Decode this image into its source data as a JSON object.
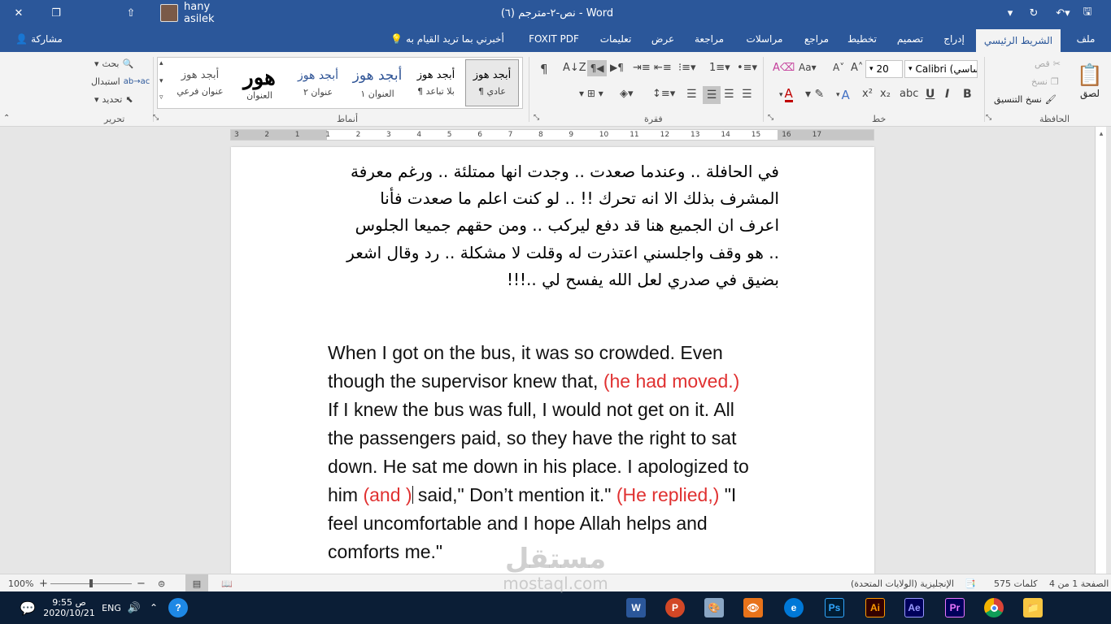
{
  "window": {
    "title": "نص-٢-مترجم (٦)  -  Word",
    "user_name": "hany asilek",
    "share_label": "مشاركة",
    "tell_me": "أخبرني بما تريد القيام به"
  },
  "tabs": [
    "ملف",
    "الشريط الرئيسي",
    "إدراج",
    "تصميم",
    "تخطيط",
    "مراجع",
    "مراسلات",
    "مراجعة",
    "عرض",
    "تعليمات",
    "FOXIT PDF"
  ],
  "active_tab": "الشريط الرئيسي",
  "ribbon": {
    "clipboard": {
      "paste": "لصق",
      "cut": "قص",
      "copy": "نسخ",
      "format_painter": "نسخ التنسيق",
      "label": "الحافظة"
    },
    "font": {
      "name": "Calibri (أساسي)",
      "size": "20",
      "label": "خط",
      "bold": "B",
      "italic": "I",
      "underline": "U",
      "grow": "A",
      "change_case": "Aa",
      "subscript": "x₂",
      "superscript": "x²",
      "text_effects": "A",
      "font_color": "A"
    },
    "paragraph": {
      "label": "فقرة",
      "pilcrow": "¶"
    },
    "styles": {
      "label": "أنماط",
      "items": [
        {
          "preview": "أبجد هوز",
          "name": "¶ عادي"
        },
        {
          "preview": "أبجد هوز",
          "name": "¶ بلا تباعد"
        },
        {
          "preview": "أبجد هوز",
          "name": "العنوان ١"
        },
        {
          "preview": "أبجد هوز",
          "name": "عنوان ٢"
        },
        {
          "preview": "هور",
          "name": "العنوان"
        },
        {
          "preview": "أبجد هوز",
          "name": "عنوان فرعي"
        }
      ]
    },
    "editing": {
      "find": "بحث",
      "replace": "استبدال",
      "select": "تحديد",
      "label": "تحرير"
    }
  },
  "document": {
    "arabic_lines": [
      "في الحافلة .. وعندما صعدت .. وجدت انها ممتلئة .. ورغم معرفة",
      "المشرف بذلك الا انه تحرك !! .. لو كنت اعلم ما صعدت فأنا",
      "اعرف ان الجميع هنا قد دفع ليركب .. ومن حقهم جميعا الجلوس",
      ".. هو وقف واجلسني اعتذرت له وقلت لا مشكلة .. رد وقال اشعر",
      "بضيق في صدري لعل الله يفسح لي ..!!!"
    ],
    "english": {
      "l1": "When I got on the bus, it was so crowded. Even",
      "l2a": "though the supervisor knew that, ",
      "l2b": "(he had moved.)",
      "l3": "If I knew the bus was full, I would not get on it. All",
      "l4": "the passengers paid, so they have the right to sat",
      "l5": "down. He sat me down in his place. I apologized to",
      "l6a": "him ",
      "l6b": "(and )",
      "l6c": " said,\" Don’t mention it.\" ",
      "l6d": "(He replied,)",
      "l6e": " \"I",
      "l7": "feel uncomfortable and I hope Allah helps and",
      "l8": "comforts me.\""
    },
    "highlight_color": "#e03131"
  },
  "ruler_numbers": [
    "3",
    "2",
    "1",
    "1",
    "2",
    "3",
    "4",
    "5",
    "6",
    "7",
    "8",
    "9",
    "10",
    "11",
    "12",
    "13",
    "14",
    "15",
    "16",
    "17"
  ],
  "status": {
    "page": "الصفحة 1 من 4",
    "words": "575 كلمات",
    "language": "الإنجليزية (الولايات المتحدة)",
    "zoom": "100%"
  },
  "taskbar": {
    "time": "9:55 ص",
    "date": "2020/10/21",
    "lang": "ENG",
    "apps": [
      "W",
      "P",
      "",
      "",
      "e",
      "Ps",
      "Ai",
      "Ae",
      "Pr",
      "",
      ""
    ]
  },
  "watermark": {
    "arabic": "مستقل",
    "latin": "mostaql.com"
  },
  "colors": {
    "word_blue": "#2b579a",
    "taskbar": "#0b1e36"
  }
}
